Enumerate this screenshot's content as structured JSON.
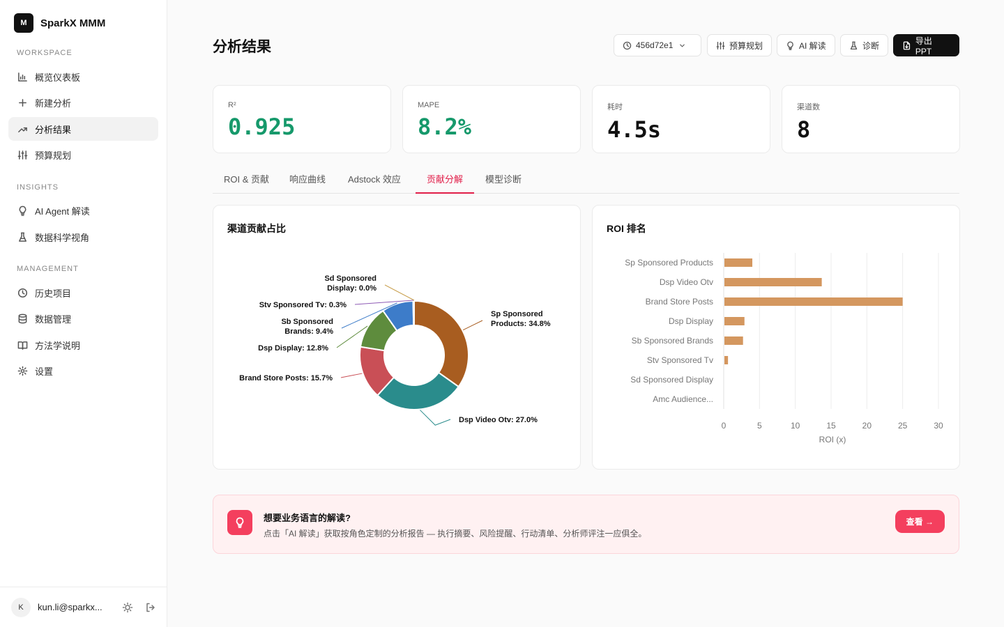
{
  "brand": {
    "logo": "M",
    "name": "SparkX MMM"
  },
  "sidebar": {
    "sections": [
      {
        "label": "WORKSPACE",
        "items": [
          {
            "label": "概览仪表板",
            "icon": "bar-chart-icon"
          },
          {
            "label": "新建分析",
            "icon": "plus-icon"
          },
          {
            "label": "分析结果",
            "icon": "trending-up-icon",
            "active": true
          },
          {
            "label": "预算规划",
            "icon": "sliders-icon"
          }
        ]
      },
      {
        "label": "INSIGHTS",
        "items": [
          {
            "label": "AI Agent 解读",
            "icon": "lightbulb-icon"
          },
          {
            "label": "数据科学视角",
            "icon": "flask-icon"
          }
        ]
      },
      {
        "label": "MANAGEMENT",
        "items": [
          {
            "label": "历史项目",
            "icon": "clock-icon"
          },
          {
            "label": "数据管理",
            "icon": "database-icon"
          },
          {
            "label": "方法学说明",
            "icon": "book-icon"
          },
          {
            "label": "设置",
            "icon": "gear-icon"
          }
        ]
      }
    ],
    "user": {
      "initial": "K",
      "email": "kun.li@sparkx..."
    }
  },
  "header": {
    "title": "分析结果",
    "version_select": "456d72e1",
    "buttons": {
      "budget": "预算规划",
      "ai": "AI 解读",
      "diagnose": "诊断",
      "export": "导出 PPT"
    }
  },
  "metrics": [
    {
      "label": "R²",
      "value": "0.925",
      "color": "#16996b"
    },
    {
      "label": "MAPE",
      "value": "8.2%",
      "color": "#16996b"
    },
    {
      "label": "耗时",
      "value": "4.5s",
      "color": "#111111"
    },
    {
      "label": "渠道数",
      "value": "8",
      "color": "#111111"
    }
  ],
  "tabs": [
    {
      "label": "ROI & 贡献"
    },
    {
      "label": "响应曲线"
    },
    {
      "label": "Adstock 效应"
    },
    {
      "label": "贡献分解",
      "active": true
    },
    {
      "label": "模型诊断"
    }
  ],
  "contribution_card": {
    "title": "渠道贡献占比"
  },
  "roi_card": {
    "title": "ROI 排名"
  },
  "chart_data": [
    {
      "type": "pie",
      "title": "渠道贡献占比",
      "slices": [
        {
          "label": "Sp Sponsored Products",
          "value": 34.8,
          "color": "#a85d20"
        },
        {
          "label": "Dsp Video Otv",
          "value": 27.0,
          "color": "#2a8c8c"
        },
        {
          "label": "Brand Store Posts",
          "value": 15.7,
          "color": "#c94f56"
        },
        {
          "label": "Dsp Display",
          "value": 12.8,
          "color": "#5e8c3d"
        },
        {
          "label": "Sb Sponsored Brands",
          "value": 9.4,
          "color": "#3d7cc9"
        },
        {
          "label": "Stv Sponsored Tv",
          "value": 0.3,
          "color": "#8e5bb5"
        },
        {
          "label": "Sd Sponsored Display",
          "value": 0.0,
          "color": "#c9a04f"
        }
      ],
      "label_texts": [
        [
          "Sp Sponsored",
          "Products: 34.8%"
        ],
        [
          "Dsp Video Otv: 27.0%"
        ],
        [
          "Brand Store Posts: 15.7%"
        ],
        [
          "Dsp Display: 12.8%"
        ],
        [
          "Sb Sponsored",
          "Brands: 9.4%"
        ],
        [
          "Stv Sponsored Tv: 0.3%"
        ],
        [
          "Sd Sponsored",
          "Display: 0.0%"
        ]
      ]
    },
    {
      "type": "bar",
      "orientation": "horizontal",
      "title": "ROI 排名",
      "categories": [
        "Sp Sponsored Products",
        "Dsp Video Otv",
        "Brand Store Posts",
        "Dsp Display",
        "Sb Sponsored Brands",
        "Stv Sponsored Tv",
        "Sd Sponsored Display",
        "Amc Audience..."
      ],
      "values": [
        3.9,
        13.6,
        24.9,
        2.8,
        2.6,
        0.5,
        0.0,
        0.0
      ],
      "xlabel": "ROI (x)",
      "xlim": [
        0,
        30
      ],
      "xticks": [
        0,
        5,
        10,
        15,
        20,
        25,
        30
      ],
      "bar_color": "#d4975f",
      "grid": true
    }
  ],
  "banner": {
    "title": "想要业务语言的解读?",
    "description": "点击「AI 解读」获取按角色定制的分析报告 — 执行摘要、风险提醒、行动清单、分析师评注一应俱全。",
    "button": "查看 →"
  }
}
